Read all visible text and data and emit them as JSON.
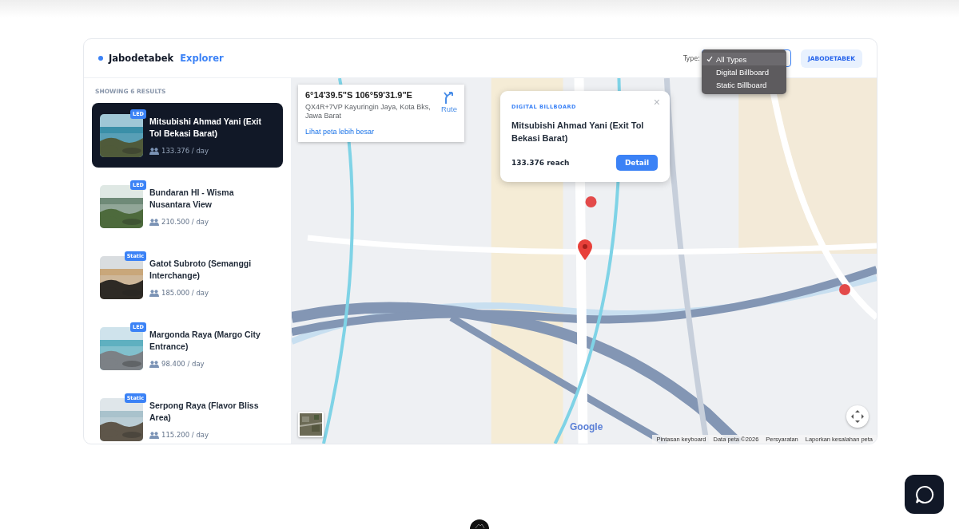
{
  "header": {
    "title": "Jabodetabek",
    "title_accent": "Explorer",
    "type_label": "Type:",
    "type_menu": [
      {
        "label": "All Types",
        "selected": true
      },
      {
        "label": "Digital Billboard",
        "selected": false
      },
      {
        "label": "Static Billboard",
        "selected": false
      }
    ],
    "region_button": "JABODETABEK"
  },
  "results": {
    "count_label": "SHOWING 6 RESULTS",
    "items": [
      {
        "title": "Mitsubishi Ahmad Yani (Exit Tol Bekasi Barat)",
        "badge": "LED",
        "reach": "133.376 / day",
        "selected": true
      },
      {
        "title": "Bundaran HI - Wisma Nusantara View",
        "badge": "LED",
        "reach": "210.500 / day",
        "selected": false
      },
      {
        "title": "Gatot Subroto (Semanggi Interchange)",
        "badge": "Static",
        "reach": "185.000 / day",
        "selected": false
      },
      {
        "title": "Margonda Raya (Margo City Entrance)",
        "badge": "LED",
        "reach": "98.400 / day",
        "selected": false
      },
      {
        "title": "Serpong Raya (Flavor Bliss Area)",
        "badge": "Static",
        "reach": "115.200 / day",
        "selected": false
      }
    ]
  },
  "map": {
    "place_card": {
      "coords": "6°14'39.5\"S 106°59'31.9\"E",
      "address": "QX4R+7VP Kayuringin Jaya, Kota Bks, Jawa Barat",
      "route": "Rute",
      "link": "Lihat peta lebih besar"
    },
    "popup": {
      "category": "DIGITAL BILLBOARD",
      "title": "Mitsubishi Ahmad Yani (Exit Tol Bekasi Barat)",
      "reach": "133.376 reach",
      "button": "Detail",
      "close": "×"
    },
    "logo": "Google",
    "attribution": [
      "Pintasan keyboard",
      "Data peta ©2026",
      "Persyaratan",
      "Laporkan kesalahan peta"
    ]
  }
}
